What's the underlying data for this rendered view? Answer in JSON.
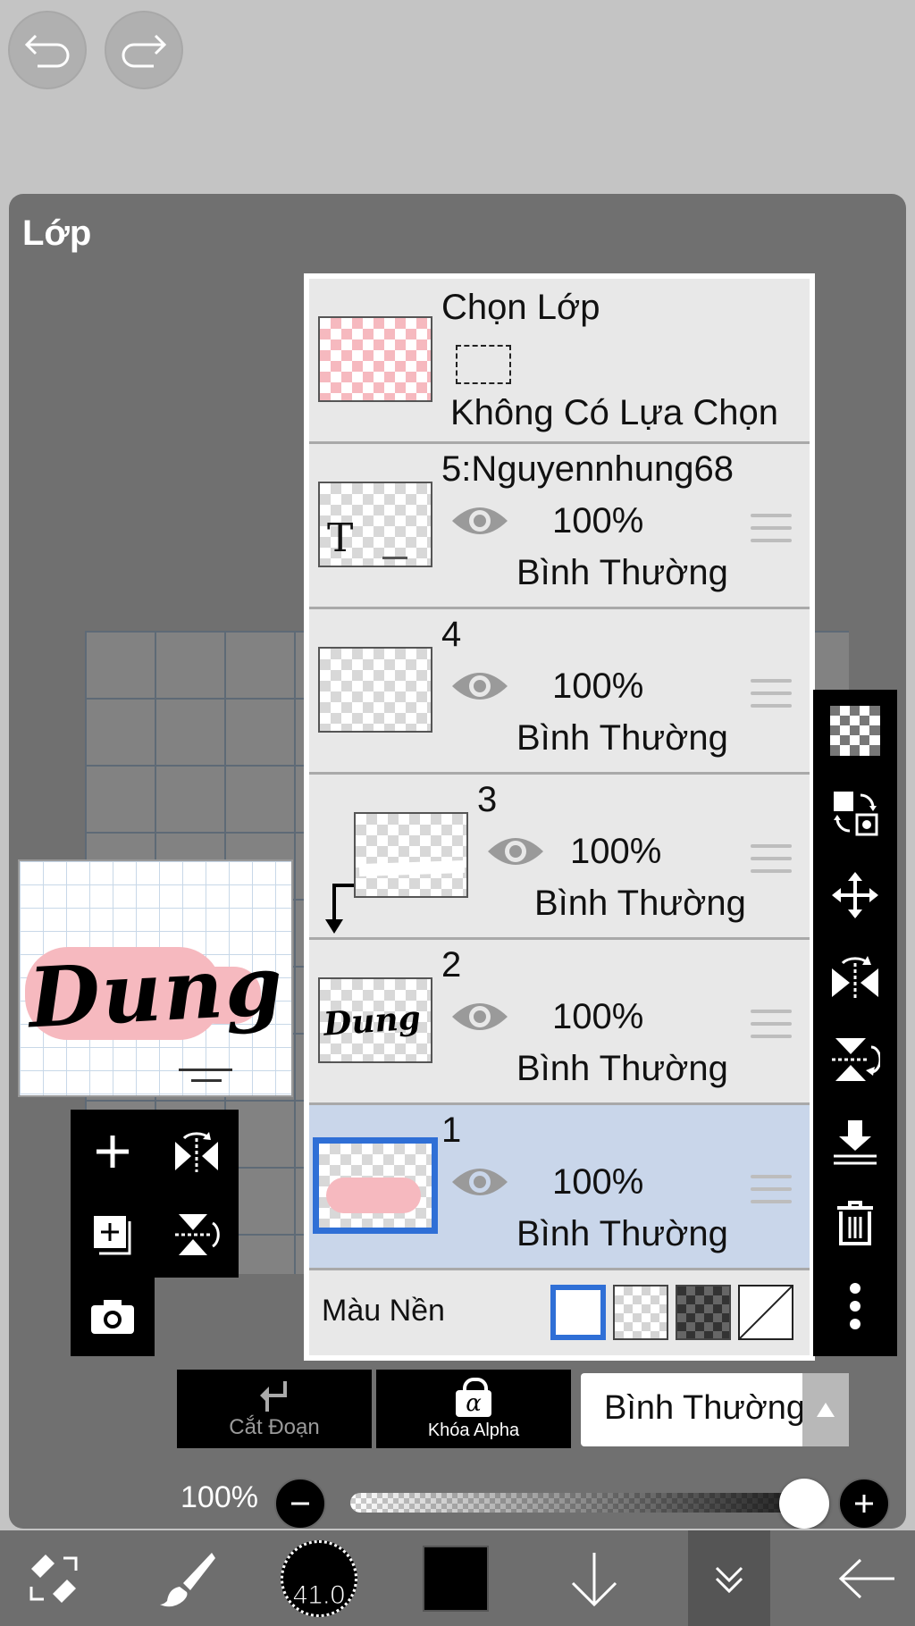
{
  "panel": {
    "title": "Lớp"
  },
  "selection": {
    "title": "Chọn Lớp",
    "status": "Không Có Lựa Chọn"
  },
  "layers": [
    {
      "name": "5:Nguyennhung68",
      "opacity": "100%",
      "mode": "Bình Thường",
      "thumb_text": "T"
    },
    {
      "name": "4",
      "opacity": "100%",
      "mode": "Bình Thường"
    },
    {
      "name": "3",
      "opacity": "100%",
      "mode": "Bình Thường",
      "clipped": true
    },
    {
      "name": "2",
      "opacity": "100%",
      "mode": "Bình Thường",
      "thumb_text": "Dung"
    },
    {
      "name": "1",
      "opacity": "100%",
      "mode": "Bình Thường",
      "selected": true
    }
  ],
  "background": {
    "label": "Màu Nền"
  },
  "controls": {
    "clip_label": "Cắt Đoạn",
    "alpha_lock_label": "Khóa Alpha",
    "alpha_symbol": "α",
    "blend_mode": "Bình Thường",
    "opacity": "100%",
    "opacity_fraction": 1.0
  },
  "preview": {
    "text": "Dung"
  },
  "bottombar": {
    "brush_size": "41.0"
  },
  "colors": {
    "accent": "#2f6fd6",
    "selected_row": "#c9d6ea",
    "pink": "#f6b9bf"
  }
}
